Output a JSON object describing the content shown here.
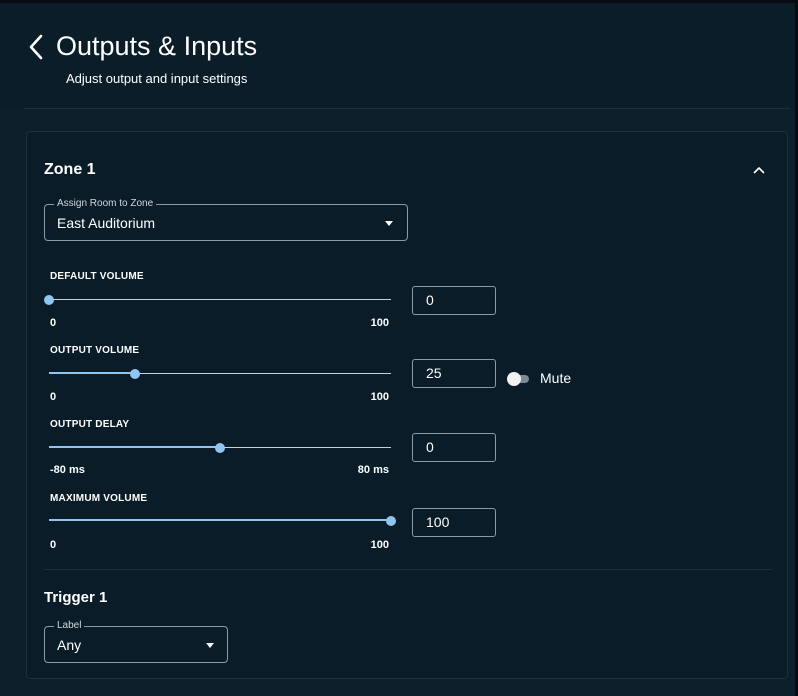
{
  "header": {
    "title": "Outputs & Inputs",
    "subtitle": "Adjust output and input settings"
  },
  "zone": {
    "title": "Zone 1",
    "room_select": {
      "label": "Assign Room to Zone",
      "value": "East Auditorium"
    },
    "controls": [
      {
        "label": "DEFAULT VOLUME",
        "min_label": "0",
        "max_label": "100",
        "value": "0",
        "fraction": 0.0
      },
      {
        "label": "OUTPUT VOLUME",
        "min_label": "0",
        "max_label": "100",
        "value": "25",
        "fraction": 0.25
      },
      {
        "label": "OUTPUT DELAY",
        "min_label": "-80 ms",
        "max_label": "80 ms",
        "value": "0",
        "fraction": 0.5
      },
      {
        "label": "MAXIMUM VOLUME",
        "min_label": "0",
        "max_label": "100",
        "value": "100",
        "fraction": 1.0
      }
    ],
    "mute": {
      "label": "Mute",
      "on": false
    }
  },
  "trigger": {
    "title": "Trigger 1",
    "label_select": {
      "label": "Label",
      "value": "Any"
    }
  },
  "colors": {
    "background": "#0d1f2b",
    "card": "#0a1c27",
    "accent": "#90c5f2"
  },
  "icons": {
    "back": "chevron-left-icon",
    "collapse": "chevron-up-icon",
    "dropdown": "caret-down-icon"
  }
}
